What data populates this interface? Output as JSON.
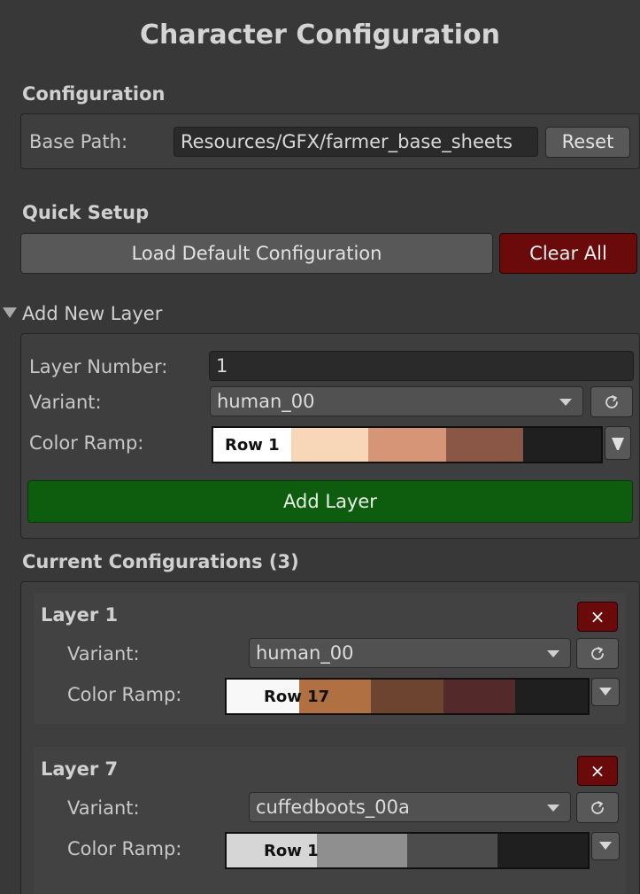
{
  "title": "Character Configuration",
  "configuration": {
    "heading": "Configuration",
    "base_path_label": "Base Path:",
    "base_path_value": "Resources/GFX/farmer_base_sheets",
    "reset_label": "Reset"
  },
  "quick_setup": {
    "heading": "Quick Setup",
    "load_default_label": "Load Default Configuration",
    "clear_all_label": "Clear All"
  },
  "add_layer": {
    "foldout_label": "Add New Layer",
    "layer_number_label": "Layer Number:",
    "layer_number_value": "1",
    "variant_label": "Variant:",
    "variant_value": "human_00",
    "color_ramp_label": "Color Ramp:",
    "ramp_row": "Row 1",
    "ramp_colors": [
      "#ffffff",
      "#f8d6b8",
      "#d69576",
      "#8a5746",
      "#1f1f1f"
    ],
    "add_button_label": "Add Layer"
  },
  "current": {
    "heading": "Current Configurations (3)",
    "layers": [
      {
        "title": "Layer 1",
        "variant_label": "Variant:",
        "variant_value": "human_00",
        "color_ramp_label": "Color Ramp:",
        "ramp_row": "Row 17",
        "ramp_colors": [
          "#f8f8f8",
          "#b07041",
          "#6d4430",
          "#532929",
          "#1f1f1f"
        ],
        "delete_label": "×"
      },
      {
        "title": "Layer 7",
        "variant_label": "Variant:",
        "variant_value": "cuffedboots_00a",
        "color_ramp_label": "Color Ramp:",
        "ramp_row": "Row 1",
        "ramp_colors": [
          "#d6d6d6",
          "#8f8f8f",
          "#4c4c4c",
          "#1f1f1f"
        ],
        "delete_label": "×"
      }
    ]
  },
  "colors": {
    "background": "#383838",
    "danger": "#6a0a0a",
    "success": "#0e5c0e"
  }
}
